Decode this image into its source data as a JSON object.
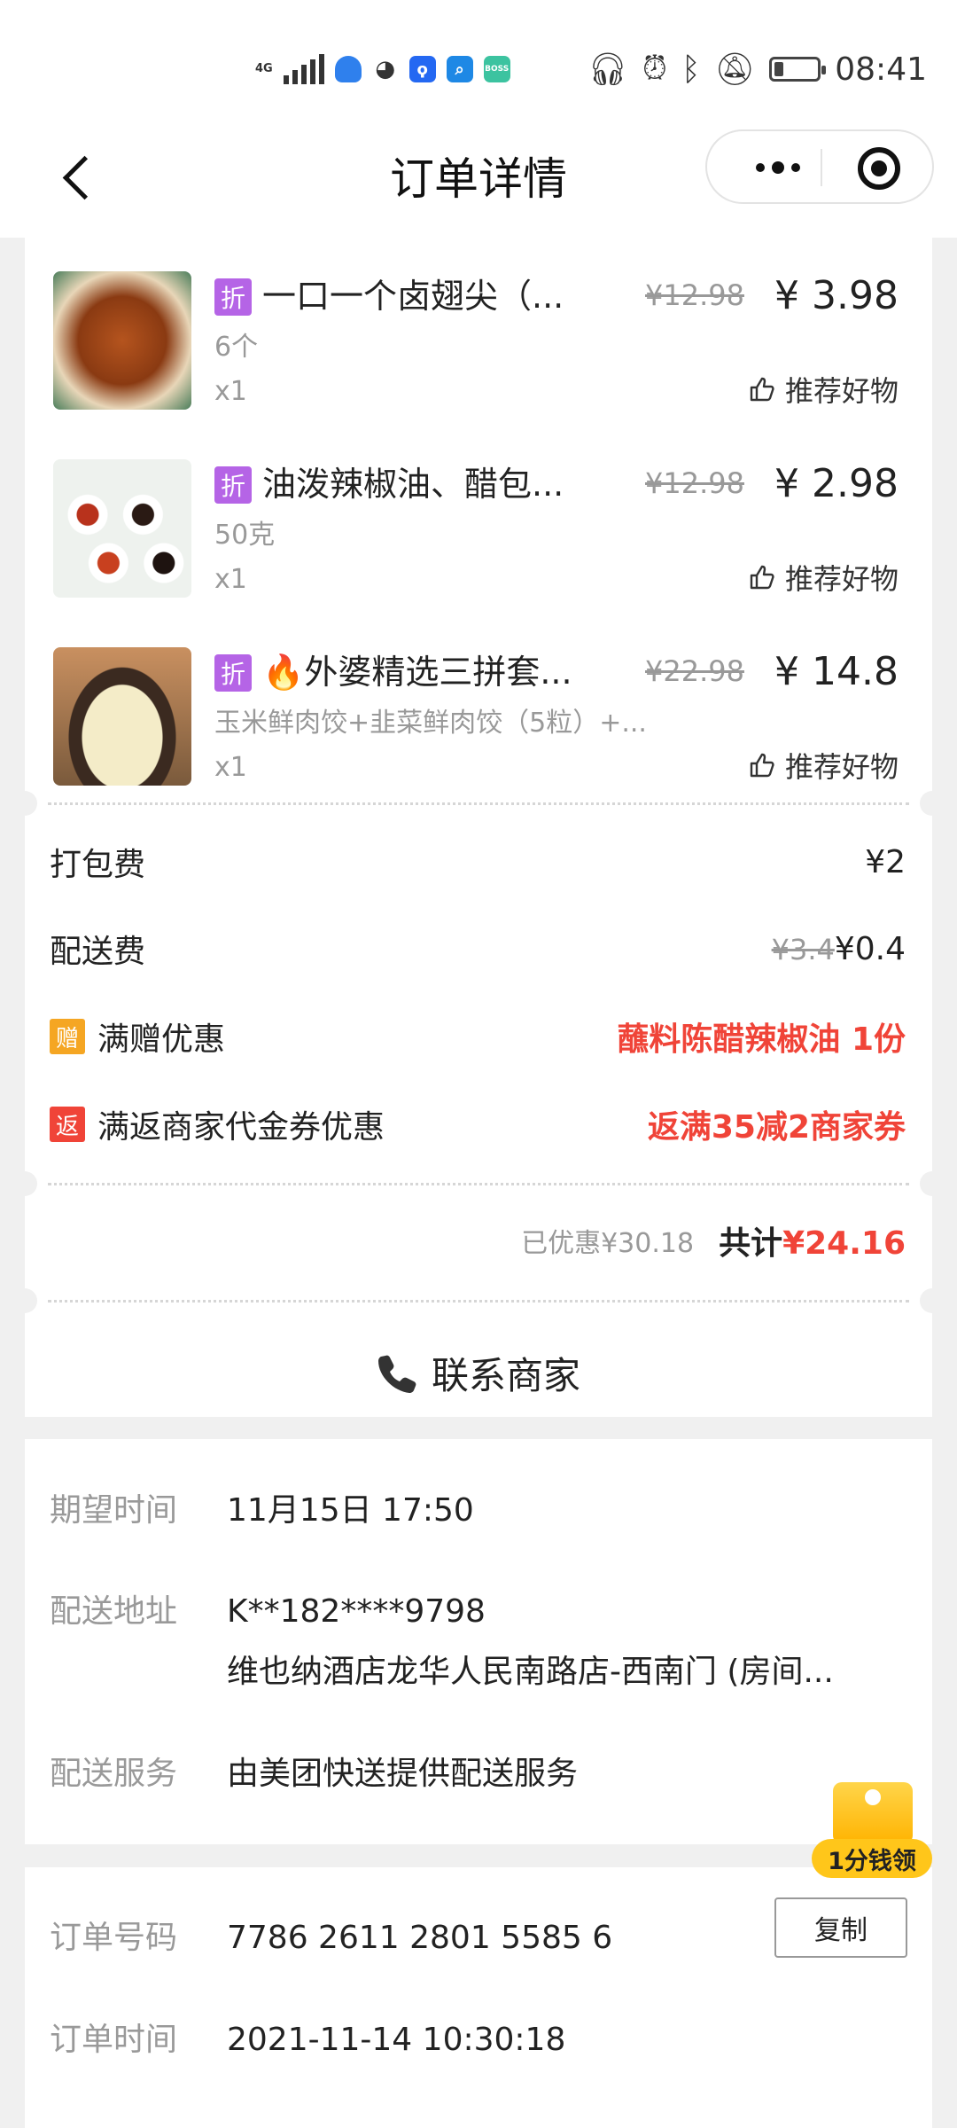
{
  "status_bar": {
    "network": "4G",
    "time": "08:41",
    "left_icons": [
      "signal-icon",
      "shield-icon",
      "wechat-icon",
      "bulb-icon",
      "search-app-icon",
      "boss-app-icon"
    ],
    "boss_label": "BOSS\n直聘",
    "right_icons": [
      "headphones-icon",
      "alarm-icon",
      "bluetooth-icon",
      "mute-icon",
      "battery-icon"
    ]
  },
  "nav": {
    "title": "订单详情"
  },
  "items": [
    {
      "discount_tag": "折",
      "name": "一口一个卤翅尖（...",
      "spec": "6个",
      "quantity": "x1",
      "original_price": "¥12.98",
      "price": "¥ 3.98",
      "recommend": "推荐好物"
    },
    {
      "discount_tag": "折",
      "name": "油泼辣椒油、醋包...",
      "spec": "50克",
      "quantity": "x1",
      "original_price": "¥12.98",
      "price": "¥ 2.98",
      "recommend": "推荐好物"
    },
    {
      "discount_tag": "折",
      "name": "🔥外婆精选三拼套...",
      "spec": "玉米鲜肉饺+韭菜鲜肉饺（5粒）+...",
      "quantity": "x1",
      "original_price": "¥22.98",
      "price": "¥ 14.8",
      "recommend": "推荐好物"
    }
  ],
  "fees": {
    "packing_label": "打包费",
    "packing_value": "¥2",
    "delivery_label": "配送费",
    "delivery_original": "¥3.4",
    "delivery_value": "¥0.4",
    "gift_badge": "赠",
    "gift_label": "满赠优惠",
    "gift_value": "蘸料陈醋辣椒油 1份",
    "return_badge": "返",
    "return_label": "满返商家代金券优惠",
    "return_value": "返满35减2商家券"
  },
  "summary": {
    "saved": "已优惠¥30.18",
    "total_label": "共计",
    "total_value": "¥24.16"
  },
  "contact": {
    "label": "联系商家"
  },
  "delivery_info": {
    "expected_label": "期望时间",
    "expected_value": "11月15日 17:50",
    "address_label": "配送地址",
    "address_contact": "K**182****9798",
    "address_detail": "维也纳酒店龙华人民南路店-西南门 (房间...",
    "service_label": "配送服务",
    "service_value": "由美团快送提供配送服务"
  },
  "order_info": {
    "number_label": "订单号码",
    "number_value": "7786 2611 2801 5585 6",
    "copy_label": "复制",
    "time_label": "订单时间",
    "time_value": "2021-11-14 10:30:18"
  },
  "promo": {
    "label": "1分钱领"
  },
  "colors": {
    "accent_red": "#f04438",
    "discount_purple": "#b564e6",
    "gift_orange": "#f5a623",
    "return_red": "#f04438"
  }
}
